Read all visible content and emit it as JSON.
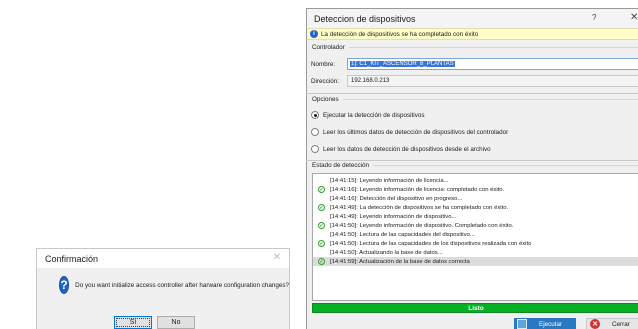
{
  "confirm_dialog": {
    "title": "Confirmación",
    "message": "Do you want initialize access controller after harware configuration changes?",
    "yes_label": "Sí",
    "no_label": "No",
    "close_glyph": "✕",
    "icon": "question-icon"
  },
  "detect_window": {
    "title": "Deteccion de dispositivos",
    "help_glyph": "?",
    "close_glyph": "✕",
    "info_message": "La detección de dispositivos se ha completado con éxito",
    "controller_section": "Controlador",
    "name_label": "Nombre:",
    "name_value": "1]: C1_KIT_ASCENSOR_8_PLANTAS",
    "address_label": "Dirección:",
    "address_value": "192.168.0.213",
    "options_section": "Opciones",
    "options": [
      {
        "label": "Ejecutar la detección de dispositivos",
        "checked": true
      },
      {
        "label": "Leer los últimos datos de detección de dispositivos del controlador",
        "checked": false
      },
      {
        "label": "Leer los datos de detección de dispositivos desde el archivo",
        "checked": false
      }
    ],
    "status_section": "Estado de detección",
    "log": [
      {
        "text": "[14:41:15]: Leyendo información de licencia...",
        "ok": false
      },
      {
        "text": "[14:41:16]: Leyendo información de licencia: completado con éxito.",
        "ok": true
      },
      {
        "text": "[14:41:16]: Detección del dispositivo en progreso...",
        "ok": false
      },
      {
        "text": "[14:41:49]: La detección de dispositivos se ha completado con éxito.",
        "ok": true
      },
      {
        "text": "[14:41:49]: Leyendo información de dispositivo...",
        "ok": false
      },
      {
        "text": "[14:41:50]: Leyendo información de dispositivo. Completado con éxito.",
        "ok": true
      },
      {
        "text": "[14:41:50]: Lectura de las capacidades del dispositivo...",
        "ok": false
      },
      {
        "text": "[14:41:50]: Lectura de las capacidades de los dispositivos realizada con éxito",
        "ok": true
      },
      {
        "text": "[14:41:50]: Actualizando la base de datos...",
        "ok": false
      },
      {
        "text": "[14:41:59]: Actualización de la base de datos correcta",
        "ok": true
      }
    ],
    "progress_label": "Listo",
    "progress_fraction": 1.0,
    "execute_label": "Ejecutar",
    "cancel_label": "Cerrar"
  },
  "colors": {
    "accent_blue": "#1f64c8",
    "progress_green": "#06b025",
    "ok_green": "#2ea02e",
    "selection_blue": "#3875d7",
    "info_bg": "#fffdc8"
  }
}
